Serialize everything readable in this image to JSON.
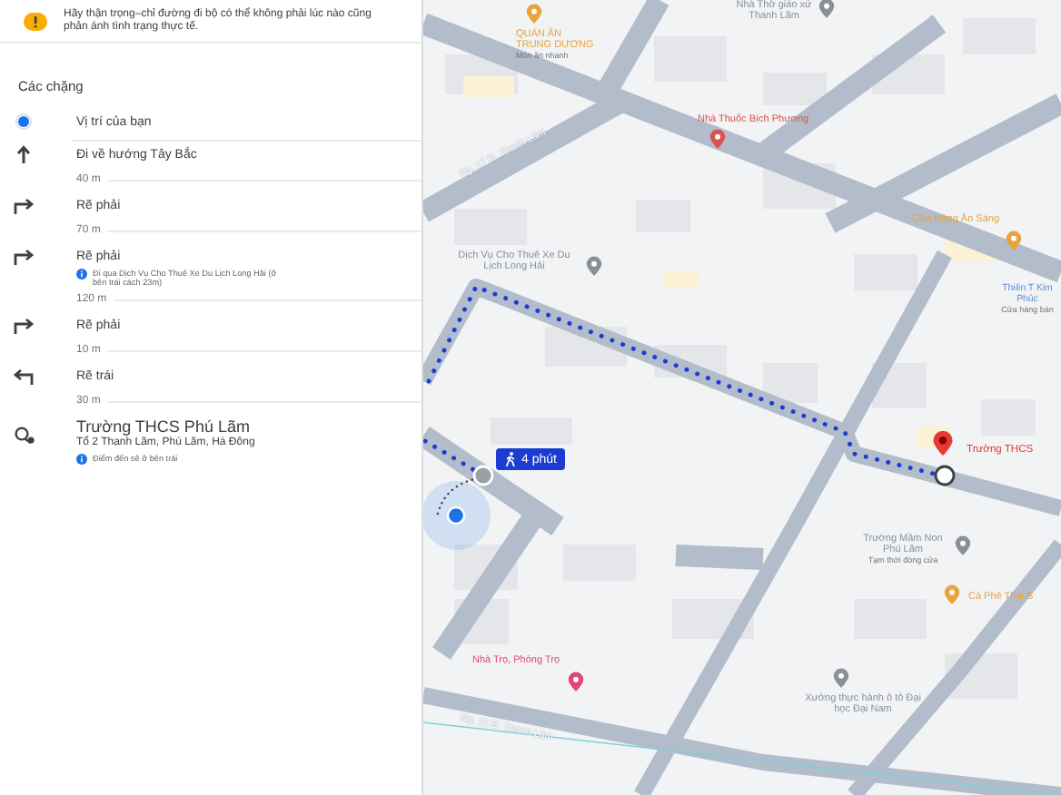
{
  "warning": {
    "text": "Hãy thận trọng–chỉ đường đi bộ có thể không phải lúc nào cũng phản ánh tình trạng thực tế."
  },
  "section_title": "Các chặng",
  "steps": [
    {
      "kind": "origin",
      "label": "Vị trí của bạn"
    },
    {
      "kind": "straight",
      "label": "Đi về hướng Tây Bắc",
      "distance": "40 m"
    },
    {
      "kind": "right",
      "label": "Rẽ phải",
      "distance": "70 m"
    },
    {
      "kind": "right",
      "label": "Rẽ phải",
      "note": "Đi qua Dịch Vụ Cho Thuê Xe Du Lịch Long Hải (ở bên trái cách 23m)",
      "distance": "120 m"
    },
    {
      "kind": "right",
      "label": "Rẽ phải",
      "distance": "10 m"
    },
    {
      "kind": "left",
      "label": "Rẽ trái",
      "distance": "30 m"
    }
  ],
  "destination": {
    "name": "Trường THCS Phú Lãm",
    "address": "Tổ 2 Thanh Lãm, Phú Lãm, Hà Đông",
    "note": "Điểm đến sẽ ở bên trái"
  },
  "map": {
    "places": [
      {
        "kind": "food",
        "name": "QUÁN ĂN TRUNG DƯƠNG",
        "detail": "Món ăn nhanh",
        "color": "#e8a33b"
      },
      {
        "kind": "church",
        "name": "Nhà Thờ giáo xứ Thanh Lãm",
        "color": "#8a9098"
      },
      {
        "kind": "pharmacy",
        "name": "Nhà Thuốc Bích Phương",
        "color": "#d9534f"
      },
      {
        "kind": "food",
        "name": "Cửa Hàng Ăn Sáng",
        "color": "#e8a33b"
      },
      {
        "kind": "service",
        "name": "Dịch Vụ Cho Thuê Xe Du Lịch Long Hải",
        "color": "#8a9098"
      },
      {
        "kind": "label",
        "name": "Thiên T Kim Phúc",
        "detail": "Cửa hàng bán",
        "color": "#5b8fd6"
      },
      {
        "kind": "destination",
        "name": "Trường THCS",
        "color": "#e53935"
      },
      {
        "kind": "school",
        "name": "Trường Mầm Non Phú Lãm",
        "detail": "Tạm thời đóng cửa",
        "color": "#8a9098"
      },
      {
        "kind": "cafe",
        "name": "Cà Phê Thái S",
        "color": "#e8a33b"
      },
      {
        "kind": "lodging",
        "name": "Nhà Trọ, Phòng Trọ",
        "color": "#e0457b"
      },
      {
        "kind": "workshop",
        "name": "Xưởng thực hành ô tô Đại học Đại Nam",
        "color": "#8a9098"
      }
    ],
    "roads": [
      {
        "name": "Ng. 17 Đ. Thanh Lãm"
      },
      {
        "name": "Ng. 11 Đ. Thanh Lãm"
      }
    ],
    "route_badge": {
      "duration": "4 phút"
    }
  }
}
